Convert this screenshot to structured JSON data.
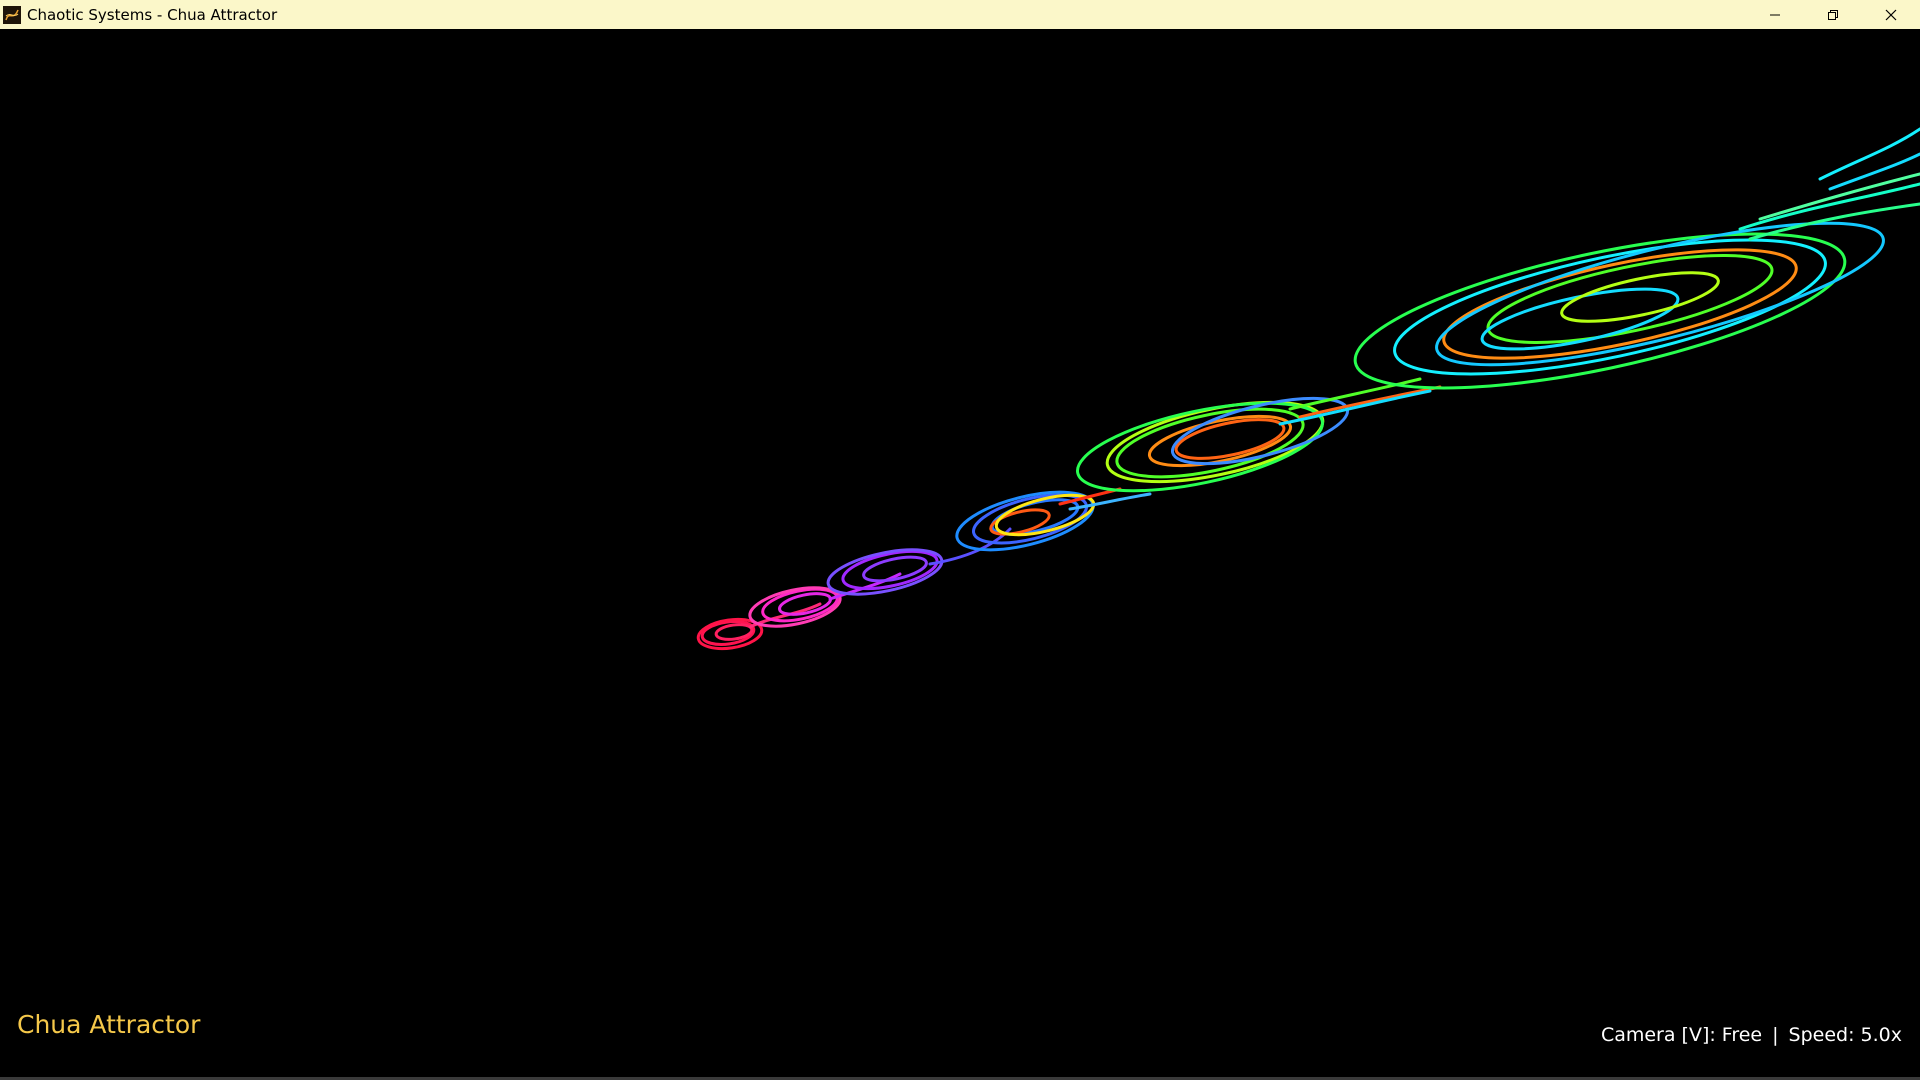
{
  "window": {
    "title": "Chaotic Systems - Chua Attractor",
    "controls": {
      "minimize_icon": "minimize-icon",
      "restore_icon": "restore-icon",
      "close_icon": "close-icon"
    }
  },
  "scene": {
    "background": "#000000",
    "trail_colors": [
      "#ff1450",
      "#ff28c8",
      "#a028ff",
      "#3c64ff",
      "#ff5a14",
      "#ffe614",
      "#50ff28",
      "#b4ff14",
      "#ff8c14",
      "#14dcff",
      "#14f0c8",
      "#28ff8c"
    ]
  },
  "hud": {
    "title": "Chua Attractor",
    "camera_label": "Camera [V]: Free",
    "separator": "|",
    "speed_label": "Speed: 5.0x",
    "title_color": "#f5c84a"
  }
}
